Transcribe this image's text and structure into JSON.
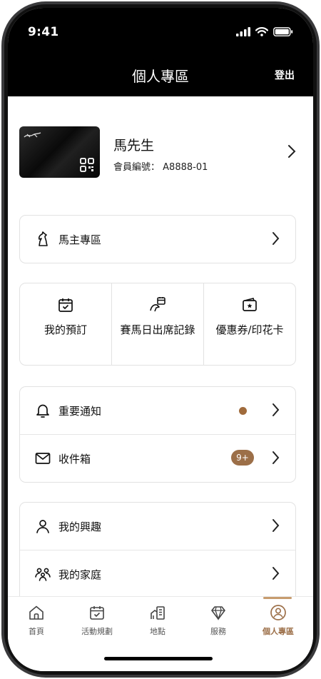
{
  "status_bar": {
    "time": "9:41"
  },
  "header": {
    "title": "個人專區",
    "logout": "登出"
  },
  "profile": {
    "name": "馬先生",
    "member_label": "會員編號：",
    "member_no": "A8888-01"
  },
  "owner_section": {
    "label": "馬主專區"
  },
  "tiles": [
    {
      "label": "我的預訂",
      "icon": "calendar-check-icon"
    },
    {
      "label": "賽馬日出席記錄",
      "icon": "horse-calendar-icon"
    },
    {
      "label": "優惠券/印花卡",
      "icon": "coupon-icon"
    }
  ],
  "notifications": {
    "label": "重要通知",
    "dot_color": "#a06b3c"
  },
  "inbox": {
    "label": "收件箱",
    "badge": "9+"
  },
  "interests": {
    "label": "我的興趣"
  },
  "family": {
    "label": "我的家庭"
  },
  "tabbar": [
    {
      "label": "首頁",
      "icon": "home-icon"
    },
    {
      "label": "活動規劃",
      "icon": "calendar-icon"
    },
    {
      "label": "地點",
      "icon": "building-icon"
    },
    {
      "label": "服務",
      "icon": "diamond-icon"
    },
    {
      "label": "個人專區",
      "icon": "profile-icon",
      "active": true
    }
  ],
  "colors": {
    "accent": "#9c6f48",
    "header_bg": "#000000"
  }
}
